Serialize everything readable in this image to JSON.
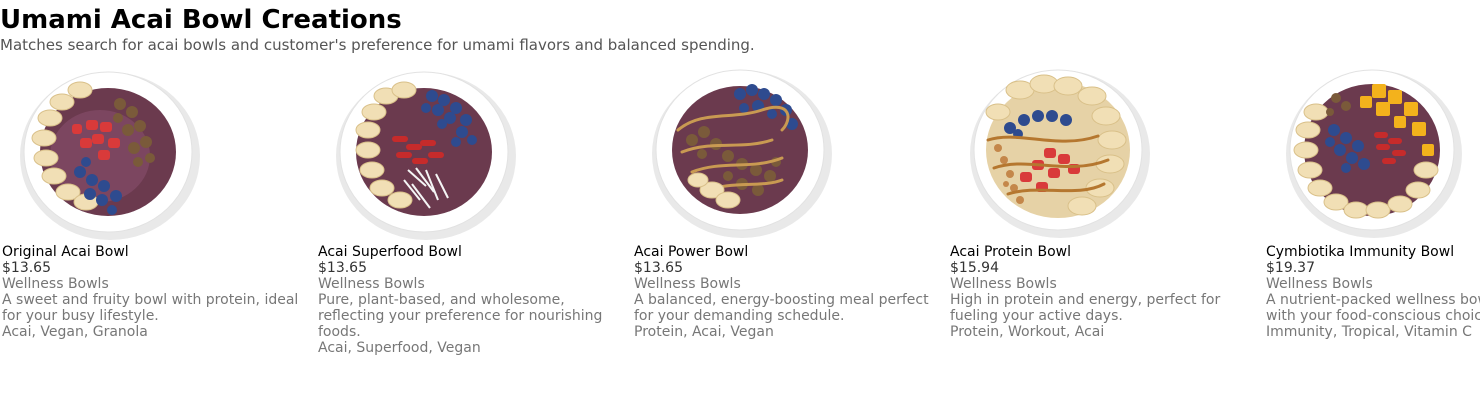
{
  "header": {
    "title": "Umami Acai Bowl Creations",
    "subtitle": "Matches search for acai bowls and customer's preference for umami flavors and balanced spending."
  },
  "products": [
    {
      "name": "Original Acai Bowl",
      "price": "$13.65",
      "category": "Wellness Bowls",
      "description": "A sweet and fruity bowl with protein, ideal for your busy lifestyle.",
      "tags": "Acai, Vegan, Granola"
    },
    {
      "name": "Acai Superfood Bowl",
      "price": "$13.65",
      "category": "Wellness Bowls",
      "description": "Pure, plant-based, and wholesome, reflecting your preference for nourishing foods.",
      "tags": "Acai, Superfood, Vegan"
    },
    {
      "name": "Acai Power Bowl",
      "price": "$13.65",
      "category": "Wellness Bowls",
      "description": "A balanced, energy-boosting meal perfect for your demanding schedule.",
      "tags": "Protein, Acai, Vegan"
    },
    {
      "name": "Acai Protein Bowl",
      "price": "$15.94",
      "category": "Wellness Bowls",
      "description": "High in protein and energy, perfect for fueling your active days.",
      "tags": "Protein, Workout, Acai"
    },
    {
      "name": "Cymbiotika Immunity Bowl",
      "price": "$19.37",
      "category": "Wellness Bowls",
      "description": "A nutrient-packed wellness bowl aligning with your food-conscious choices.",
      "tags": "Immunity, Tropical, Vitamin C"
    }
  ]
}
